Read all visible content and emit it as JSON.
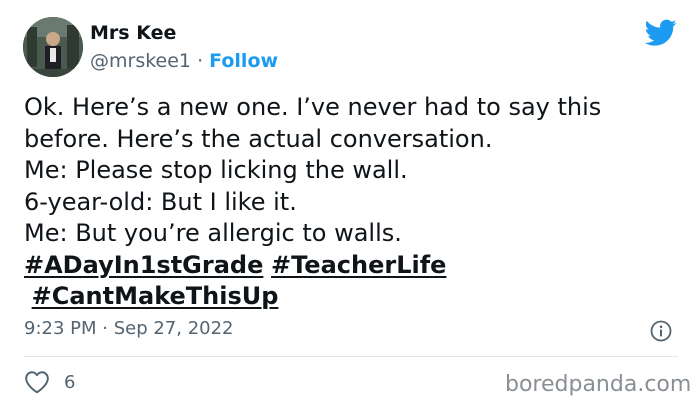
{
  "author": {
    "name": "Mrs Kee",
    "handle": "@mrskee1",
    "separator": "·",
    "follow_label": "Follow",
    "avatar_icon": "user-avatar"
  },
  "tweet": {
    "lines": [
      "Ok. Here’s a new one. I’ve never had to say this",
      "before. Here’s the actual conversation.",
      "Me: Please stop licking the wall.",
      "6-year-old: But I like it.",
      "Me: But you’re allergic to walls."
    ],
    "hashtags": [
      "#ADayIn1stGrade",
      "#TeacherLife",
      "#CantMakeThisUp"
    ]
  },
  "meta": {
    "timestamp": "9:23 PM · Sep 27, 2022",
    "likes": "6"
  },
  "watermark": "boredpanda.com",
  "colors": {
    "twitter_blue": "#1d9bf0",
    "text": "#0f1419",
    "muted": "#536471",
    "divider": "#e1e8ed"
  },
  "icons": {
    "brand": "twitter-bird-icon",
    "info": "info-icon",
    "like": "heart-icon"
  }
}
